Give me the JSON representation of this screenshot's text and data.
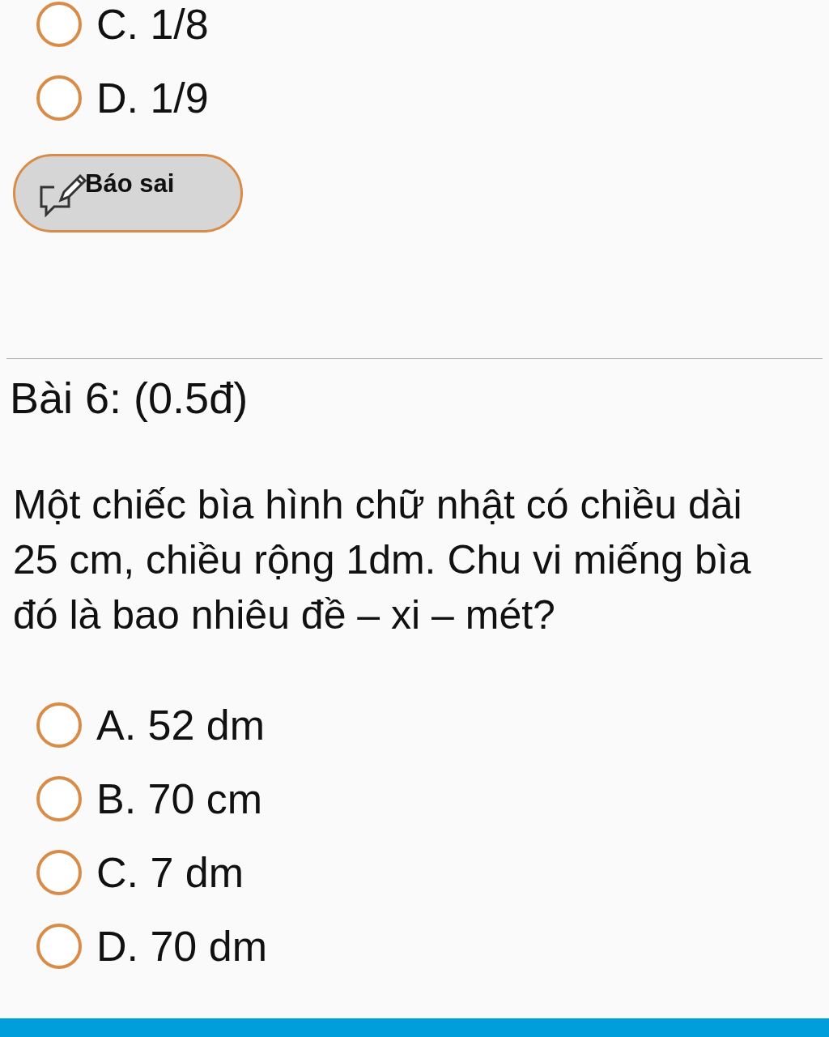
{
  "previous_question": {
    "options": [
      {
        "label": "C. 1/8",
        "selected": false
      },
      {
        "label": "D. 1/9",
        "selected": false
      }
    ]
  },
  "report_button": {
    "label": "Báo sai"
  },
  "question": {
    "title": "Bài 6: (0.5đ)",
    "text": "Một chiếc bìa hình chữ nhật có chiều dài 25 cm, chiều rộng 1dm. Chu vi miếng bìa đó là bao nhiêu đề – xi – mét?",
    "options": [
      {
        "label": "A. 52 dm",
        "selected": false
      },
      {
        "label": "B. 70 cm",
        "selected": false
      },
      {
        "label": "C. 7 dm",
        "selected": false
      },
      {
        "label": "D. 70 dm",
        "selected": false
      }
    ]
  }
}
